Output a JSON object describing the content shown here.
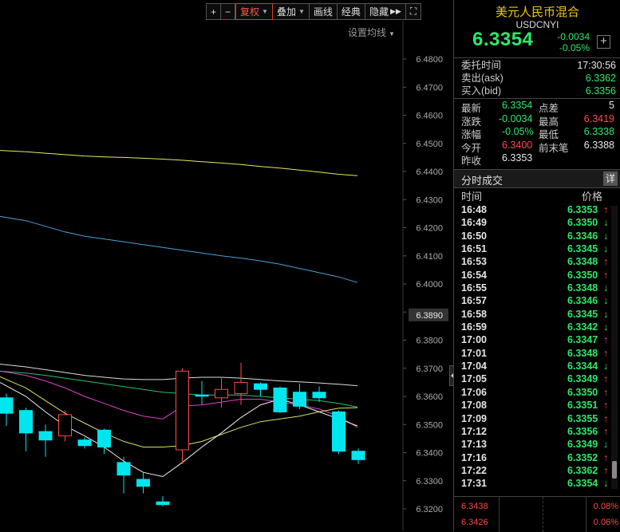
{
  "toolbar": {
    "zoom_in": "+",
    "zoom_out": "−",
    "restore": "复权",
    "overlay": "叠加",
    "draw": "画线",
    "classic": "经典",
    "hide": "隐藏",
    "expand": "⛶"
  },
  "ma_setting": "设置均线",
  "chart_data": {
    "type": "candlestick",
    "y_ticks": [
      "6.4800",
      "6.4700",
      "6.4600",
      "6.4500",
      "6.4400",
      "6.4300",
      "6.4200",
      "6.4100",
      "6.4000",
      "6.3900",
      "6.3800",
      "6.3700",
      "6.3600",
      "6.3500",
      "6.3400",
      "6.3300",
      "6.3200"
    ],
    "ylim": [
      6.3165,
      6.4845
    ],
    "current_price_label": "6.3890",
    "current_price": 6.389,
    "candles": [
      {
        "o": 6.3595,
        "c": 6.354,
        "h": 6.361,
        "l": 6.3495
      },
      {
        "o": 6.355,
        "c": 6.347,
        "h": 6.356,
        "l": 6.3405
      },
      {
        "o": 6.3475,
        "c": 6.3445,
        "h": 6.35,
        "l": 6.3385
      },
      {
        "o": 6.346,
        "c": 6.3535,
        "h": 6.355,
        "l": 6.344
      },
      {
        "o": 6.3445,
        "c": 6.3425,
        "h": 6.3455,
        "l": 6.3415
      },
      {
        "o": 6.348,
        "c": 6.342,
        "h": 6.3485,
        "l": 6.3395
      },
      {
        "o": 6.3365,
        "c": 6.332,
        "h": 6.3385,
        "l": 6.3255
      },
      {
        "o": 6.3305,
        "c": 6.328,
        "h": 6.333,
        "l": 6.3255
      },
      {
        "o": 6.3225,
        "c": 6.3215,
        "h": 6.3245,
        "l": 6.321
      },
      {
        "o": 6.341,
        "c": 6.369,
        "h": 6.37,
        "l": 6.336
      },
      {
        "o": 6.3605,
        "c": 6.3605,
        "h": 6.3655,
        "l": 6.357
      },
      {
        "o": 6.3595,
        "c": 6.3625,
        "h": 6.3665,
        "l": 6.356
      },
      {
        "o": 6.361,
        "c": 6.365,
        "h": 6.372,
        "l": 6.357
      },
      {
        "o": 6.3645,
        "c": 6.3625,
        "h": 6.365,
        "l": 6.36
      },
      {
        "o": 6.363,
        "c": 6.3545,
        "h": 6.3635,
        "l": 6.354
      },
      {
        "o": 6.3615,
        "c": 6.3565,
        "h": 6.3645,
        "l": 6.3555
      },
      {
        "o": 6.3615,
        "c": 6.3595,
        "h": 6.3635,
        "l": 6.358
      },
      {
        "o": 6.3545,
        "c": 6.3405,
        "h": 6.355,
        "l": 6.3395
      },
      {
        "o": 6.3405,
        "c": 6.3375,
        "h": 6.3415,
        "l": 6.336
      }
    ],
    "ma_lines": [
      {
        "color": "#e8e66a",
        "points": [
          [
            0,
            6.4475
          ],
          [
            1,
            6.447
          ],
          [
            2,
            6.4465
          ],
          [
            3,
            6.446
          ],
          [
            4,
            6.4455
          ],
          [
            5,
            6.4452
          ],
          [
            6,
            6.445
          ],
          [
            7,
            6.4447
          ],
          [
            8,
            6.4444
          ],
          [
            9,
            6.444
          ],
          [
            10,
            6.4435
          ],
          [
            11,
            6.443
          ],
          [
            12,
            6.4425
          ],
          [
            13,
            6.4418
          ],
          [
            14,
            6.4412
          ],
          [
            15,
            6.4405
          ],
          [
            16,
            6.4398
          ],
          [
            17,
            6.439
          ],
          [
            18,
            6.4385
          ]
        ]
      },
      {
        "color": "#4aa0d8",
        "points": [
          [
            0,
            6.424
          ],
          [
            1,
            6.4225
          ],
          [
            2,
            6.4205
          ],
          [
            3,
            6.4185
          ],
          [
            4,
            6.417
          ],
          [
            5,
            6.416
          ],
          [
            6,
            6.415
          ],
          [
            7,
            6.414
          ],
          [
            8,
            6.413
          ],
          [
            9,
            6.412
          ],
          [
            10,
            6.411
          ],
          [
            11,
            6.41
          ],
          [
            12,
            6.4092
          ],
          [
            13,
            6.4082
          ],
          [
            14,
            6.407
          ],
          [
            15,
            6.4055
          ],
          [
            16,
            6.404
          ],
          [
            17,
            6.4025
          ],
          [
            18,
            6.4005
          ]
        ]
      },
      {
        "color": "#dcdcdc",
        "points": [
          [
            0,
            6.3715
          ],
          [
            1,
            6.3705
          ],
          [
            2,
            6.3695
          ],
          [
            3,
            6.3685
          ],
          [
            4,
            6.3675
          ],
          [
            5,
            6.3668
          ],
          [
            6,
            6.3662
          ],
          [
            7,
            6.366
          ],
          [
            8,
            6.366
          ],
          [
            9,
            6.3665
          ],
          [
            10,
            6.3668
          ],
          [
            11,
            6.3668
          ],
          [
            12,
            6.3665
          ],
          [
            13,
            6.366
          ],
          [
            14,
            6.3655
          ],
          [
            15,
            6.3652
          ],
          [
            16,
            6.3648
          ],
          [
            17,
            6.3643
          ],
          [
            18,
            6.3638
          ]
        ]
      },
      {
        "color": "#28c26a",
        "points": [
          [
            0,
            6.369
          ],
          [
            1,
            6.3683
          ],
          [
            2,
            6.3675
          ],
          [
            3,
            6.3665
          ],
          [
            4,
            6.3655
          ],
          [
            5,
            6.3645
          ],
          [
            6,
            6.3635
          ],
          [
            7,
            6.3625
          ],
          [
            8,
            6.3615
          ],
          [
            9,
            6.361
          ],
          [
            10,
            6.3605
          ],
          [
            11,
            6.3605
          ],
          [
            12,
            6.3605
          ],
          [
            13,
            6.36
          ],
          [
            14,
            6.3595
          ],
          [
            15,
            6.359
          ],
          [
            16,
            6.3585
          ],
          [
            17,
            6.3575
          ],
          [
            18,
            6.3562
          ]
        ]
      },
      {
        "color": "#e040c8",
        "points": [
          [
            0,
            6.369
          ],
          [
            1,
            6.3675
          ],
          [
            2,
            6.3655
          ],
          [
            3,
            6.363
          ],
          [
            4,
            6.36
          ],
          [
            5,
            6.3575
          ],
          [
            6,
            6.355
          ],
          [
            7,
            6.353
          ],
          [
            8,
            6.352
          ],
          [
            9,
            6.3565
          ],
          [
            10,
            6.357
          ],
          [
            11,
            6.358
          ],
          [
            12,
            6.359
          ],
          [
            13,
            6.359
          ],
          [
            14,
            6.358
          ],
          [
            15,
            6.357
          ],
          [
            16,
            6.3555
          ],
          [
            17,
            6.353
          ],
          [
            18,
            6.349
          ]
        ]
      },
      {
        "color": "#dede6a",
        "points": [
          [
            0,
            6.367
          ],
          [
            1,
            6.363
          ],
          [
            2,
            6.3585
          ],
          [
            3,
            6.354
          ],
          [
            4,
            6.3505
          ],
          [
            5,
            6.347
          ],
          [
            6,
            6.344
          ],
          [
            7,
            6.342
          ],
          [
            8,
            6.342
          ],
          [
            9,
            6.3425
          ],
          [
            10,
            6.344
          ],
          [
            11,
            6.3465
          ],
          [
            12,
            6.349
          ],
          [
            13,
            6.351
          ],
          [
            14,
            6.352
          ],
          [
            15,
            6.353
          ],
          [
            16,
            6.3545
          ],
          [
            17,
            6.3558
          ],
          [
            18,
            6.356
          ]
        ]
      },
      {
        "color": "#f0f0f0",
        "points": [
          [
            0,
            6.365
          ],
          [
            1,
            6.36
          ],
          [
            2,
            6.3545
          ],
          [
            3,
            6.3495
          ],
          [
            4,
            6.346
          ],
          [
            5,
            6.342
          ],
          [
            6,
            6.337
          ],
          [
            7,
            6.333
          ],
          [
            8,
            6.3315
          ],
          [
            9,
            6.3365
          ],
          [
            10,
            6.342
          ],
          [
            11,
            6.347
          ],
          [
            12,
            6.3525
          ],
          [
            13,
            6.357
          ],
          [
            14,
            6.359
          ],
          [
            15,
            6.357
          ],
          [
            16,
            6.3545
          ],
          [
            17,
            6.352
          ],
          [
            18,
            6.3495
          ]
        ]
      }
    ]
  },
  "info": {
    "title": "美元人民币混合",
    "code": "USDCNYI",
    "price": "6.3354",
    "change": "-0.0034",
    "change_pct": "-0.05%",
    "plus": "+",
    "order_time_label": "委托时间",
    "order_time": "17:30:56",
    "ask_label": "卖出(ask)",
    "ask": "6.3362",
    "bid_label": "买入(bid)",
    "bid": "6.3356",
    "latest_label": "最新",
    "latest": "6.3354",
    "spread_label": "点差",
    "spread": "5",
    "chg_label": "涨跌",
    "chg": "-0.0034",
    "high_label": "最高",
    "high": "6.3419",
    "pct_label": "涨幅",
    "pct": "-0.05%",
    "low_label": "最低",
    "low": "6.3338",
    "open_label": "今开",
    "open": "6.3400",
    "last_label": "前末笔",
    "last": "6.3388",
    "prev_close_label": "昨收",
    "prev_close": "6.3353"
  },
  "trades": {
    "title": "分时成交",
    "detail": "详",
    "col_time": "时间",
    "col_price": "价格",
    "rows": [
      {
        "time": "16:48",
        "price": "6.3353",
        "dir": "up"
      },
      {
        "time": "16:49",
        "price": "6.3350",
        "dir": "down"
      },
      {
        "time": "16:50",
        "price": "6.3346",
        "dir": "down"
      },
      {
        "time": "16:51",
        "price": "6.3345",
        "dir": "down"
      },
      {
        "time": "16:53",
        "price": "6.3348",
        "dir": "up"
      },
      {
        "time": "16:54",
        "price": "6.3350",
        "dir": "up"
      },
      {
        "time": "16:55",
        "price": "6.3348",
        "dir": "down"
      },
      {
        "time": "16:57",
        "price": "6.3346",
        "dir": "down"
      },
      {
        "time": "16:58",
        "price": "6.3345",
        "dir": "down"
      },
      {
        "time": "16:59",
        "price": "6.3342",
        "dir": "down"
      },
      {
        "time": "17:00",
        "price": "6.3347",
        "dir": "up"
      },
      {
        "time": "17:01",
        "price": "6.3348",
        "dir": "up"
      },
      {
        "time": "17:04",
        "price": "6.3344",
        "dir": "down"
      },
      {
        "time": "17:05",
        "price": "6.3349",
        "dir": "up"
      },
      {
        "time": "17:06",
        "price": "6.3350",
        "dir": "up"
      },
      {
        "time": "17:08",
        "price": "6.3351",
        "dir": "up"
      },
      {
        "time": "17:09",
        "price": "6.3355",
        "dir": "up"
      },
      {
        "time": "17:12",
        "price": "6.3356",
        "dir": "up"
      },
      {
        "time": "17:13",
        "price": "6.3349",
        "dir": "down"
      },
      {
        "time": "17:16",
        "price": "6.3352",
        "dir": "up"
      },
      {
        "time": "17:22",
        "price": "6.3362",
        "dir": "up"
      },
      {
        "time": "17:31",
        "price": "6.3354",
        "dir": "down"
      }
    ]
  },
  "mini": {
    "price_top": "6.3438",
    "pct_top": "0.08%",
    "price_bottom": "6.3426",
    "pct_bottom": "0.06%"
  },
  "colors": {
    "up": "#ff4a4a",
    "down": "#2ee86a",
    "bull_candle": "#ff4a4a",
    "bear_candle": "#00e5ee"
  }
}
